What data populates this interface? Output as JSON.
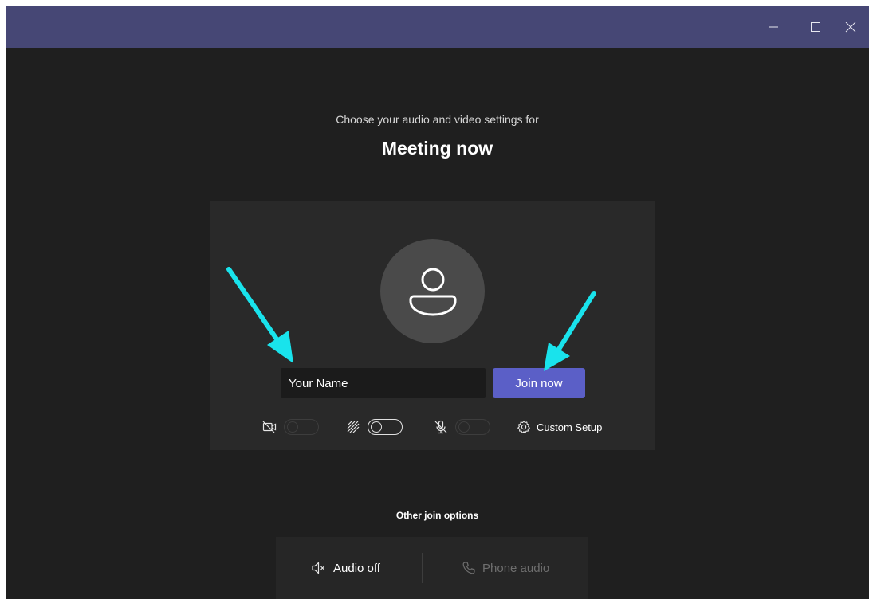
{
  "window": {
    "controls": [
      "minimize",
      "maximize",
      "close"
    ],
    "titlebar_color": "#464775"
  },
  "prejoin": {
    "subtitle": "Choose your audio and video settings for",
    "meeting_title": "Meeting now",
    "name_input": {
      "value": "",
      "placeholder": "Your Name"
    },
    "join_button_label": "Join now",
    "accent_color": "#5b5fc7",
    "toggles": {
      "camera": {
        "icon": "camera-off-icon",
        "on": false
      },
      "background_blur": {
        "icon": "background-blur-icon",
        "on": true
      },
      "microphone": {
        "icon": "mic-off-icon",
        "on": false
      }
    },
    "custom_setup": {
      "icon": "gear-icon",
      "label": "Custom Setup"
    }
  },
  "other_join": {
    "title": "Other join options",
    "audio_off": {
      "icon": "speaker-muted-icon",
      "label": "Audio off"
    },
    "phone_audio": {
      "icon": "phone-icon",
      "label": "Phone audio"
    }
  },
  "annotations": {
    "arrow_color": "#19e3ec",
    "arrows": [
      "arrow-to-name-input",
      "arrow-to-join-button"
    ]
  }
}
